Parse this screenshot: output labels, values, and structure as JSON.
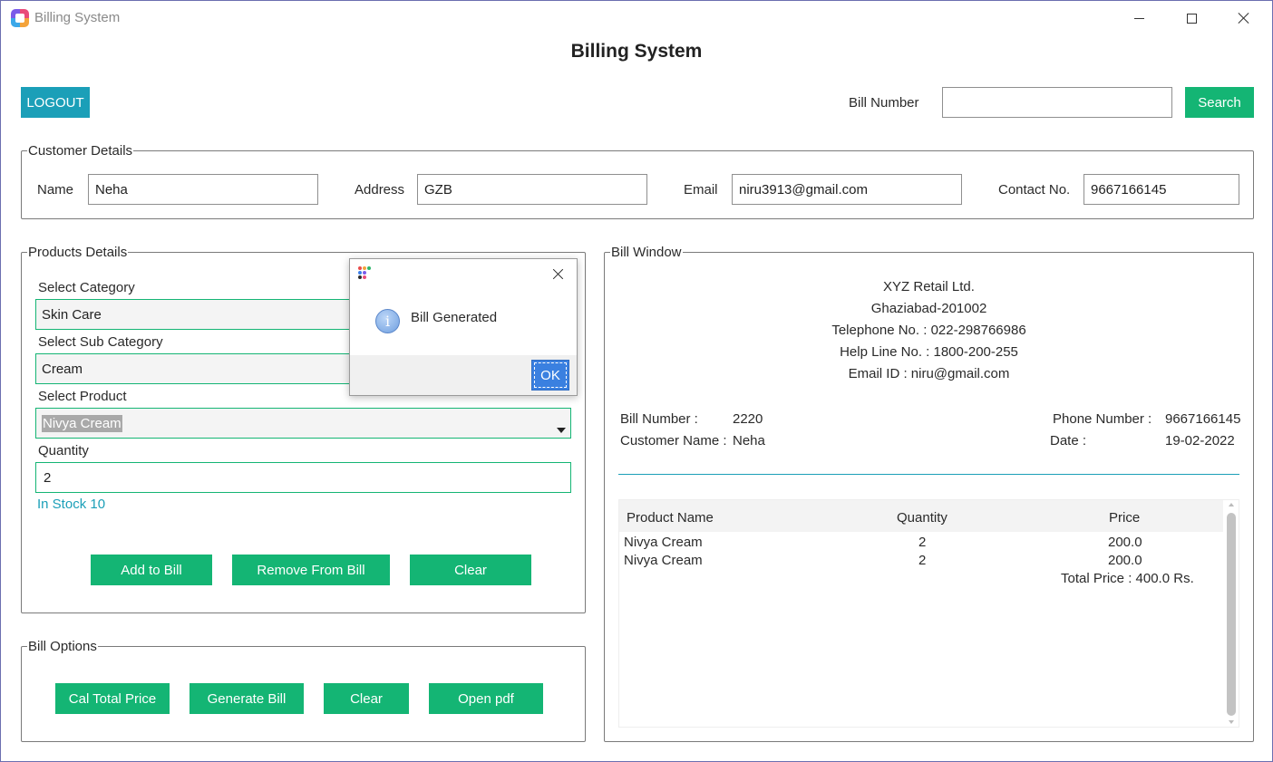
{
  "window": {
    "title": "Billing System"
  },
  "header": {
    "heading": "Billing System",
    "logout_label": "LOGOUT",
    "bill_number_label": "Bill Number",
    "bill_number_value": "",
    "search_label": "Search"
  },
  "customer": {
    "legend": "Customer Details",
    "name_label": "Name",
    "name_value": "Neha",
    "address_label": "Address",
    "address_value": "GZB",
    "email_label": "Email",
    "email_value": "niru3913@gmail.com",
    "contact_label": "Contact No.",
    "contact_value": "9667166145"
  },
  "products": {
    "legend": "Products Details",
    "category_label": "Select Category",
    "category_value": "Skin Care",
    "subcategory_label": "Select Sub Category",
    "subcategory_value": "Cream",
    "product_label": "Select Product",
    "product_value": "Nivya Cream",
    "quantity_label": "Quantity",
    "quantity_value": "2",
    "stock_text": "In Stock 10",
    "add_label": "Add to Bill",
    "remove_label": "Remove From Bill",
    "clear_label": "Clear"
  },
  "options": {
    "legend": "Bill Options",
    "total_label": "Cal Total Price",
    "generate_label": "Generate Bill",
    "clear_label": "Clear",
    "pdf_label": "Open pdf"
  },
  "bill": {
    "legend": "Bill Window",
    "company": "XYZ Retail Ltd.",
    "city": "Ghaziabad-201002",
    "telephone": "Telephone No. : 022-298766986",
    "helpline": "Help Line No. : 1800-200-255",
    "email": "Email ID : niru@gmail.com",
    "bill_number_label": "Bill Number :",
    "bill_number_value": "2220",
    "customer_name_label": "Customer Name :",
    "customer_name_value": "Neha",
    "phone_label": "Phone Number :",
    "phone_value": "9667166145",
    "date_label": "Date :",
    "date_value": "19-02-2022",
    "columns": [
      "Product Name",
      "Quantity",
      "Price"
    ],
    "rows": [
      {
        "product": "Nivya Cream",
        "quantity": "2",
        "price": "200.0"
      },
      {
        "product": "Nivya Cream",
        "quantity": "2",
        "price": "200.0"
      }
    ],
    "total": "Total Price : 400.0 Rs."
  },
  "dialog": {
    "message": "Bill Generated",
    "ok_label": "OK"
  },
  "colors": {
    "teal": "#1b9fb8",
    "green": "#14b574",
    "dialog_ok": "#3a80e0"
  }
}
